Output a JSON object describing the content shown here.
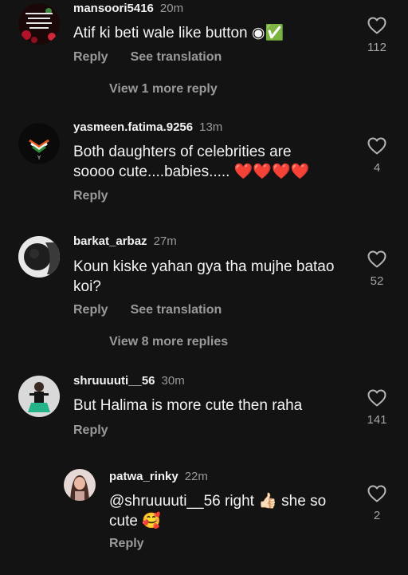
{
  "colors": {
    "background": "#131313",
    "primary_text": "#f2f2f2",
    "secondary_text": "#9a9a9a",
    "heart_red": "#e8232f"
  },
  "comments": [
    {
      "username": "mansoori5416",
      "time": "20m",
      "text": "Atif ki beti wale like button ◉✅",
      "reply": "Reply",
      "translate": "See translation",
      "likes": "112",
      "avatar_lines": [
        "ہم چاہتے ہیں",
        "محبت ہی محبت",
        "سوچ کر دیکھو"
      ]
    },
    {
      "username": "yasmeen.fatima.9256",
      "time": "13m",
      "text": "Both daughters of celebrities are soooo cute....babies..... ❤️❤️❤️❤️",
      "reply": "Reply",
      "likes": "4"
    },
    {
      "username": "barkat_arbaz",
      "time": "27m",
      "text": "Koun kiske yahan gya tha mujhe batao koi?",
      "reply": "Reply",
      "translate": "See translation",
      "likes": "52"
    },
    {
      "username": "shruuuuti__56",
      "time": "30m",
      "text": "But Halima is more cute then raha",
      "reply": "Reply",
      "likes": "141"
    },
    {
      "username": "patwa_rinky",
      "time": "22m",
      "text": "@shruuuuti__56 right 👍🏻 she so cute 🥰",
      "reply": "Reply",
      "likes": "2"
    }
  ],
  "view_more": [
    "View 1 more reply",
    "View 8 more replies"
  ]
}
